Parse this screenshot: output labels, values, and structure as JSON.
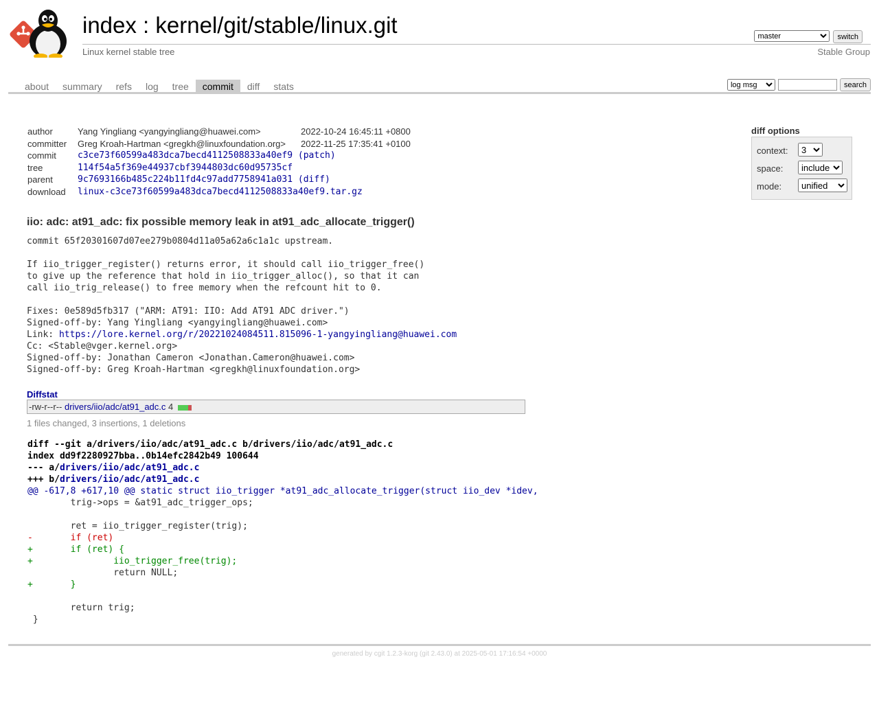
{
  "header": {
    "index_label": "index",
    "separator": " : ",
    "repo_path": "kernel/git/stable/linux.git",
    "description": "Linux kernel stable tree",
    "owner": "Stable Group",
    "branch": "master",
    "switch_label": "switch",
    "logo_icon": "git-penguin-logo"
  },
  "tabs": [
    {
      "label": "about",
      "active": false
    },
    {
      "label": "summary",
      "active": false
    },
    {
      "label": "refs",
      "active": false
    },
    {
      "label": "log",
      "active": false
    },
    {
      "label": "tree",
      "active": false
    },
    {
      "label": "commit",
      "active": true
    },
    {
      "label": "diff",
      "active": false
    },
    {
      "label": "stats",
      "active": false
    }
  ],
  "search": {
    "type": "log msg",
    "query": "",
    "button_label": "search"
  },
  "commit_info": {
    "author_label": "author",
    "author": "Yang Yingliang <yangyingliang@huawei.com>",
    "author_date": "2022-10-24 16:45:11 +0800",
    "committer_label": "committer",
    "committer": "Greg Kroah-Hartman <gregkh@linuxfoundation.org>",
    "committer_date": "2022-11-25 17:35:41 +0100",
    "commit_label": "commit",
    "commit_hash": "c3ce73f60599a483dca7becd4112508833a40ef9",
    "patch_label": "patch",
    "tree_label": "tree",
    "tree_hash": "114f54a5f369e44937cbf3944803dc60d95735cf",
    "parent_label": "parent",
    "parent_hash": "9c7693166b485c224b11fd4c97add7758941a031",
    "diff_label": "diff",
    "download_label": "download",
    "download_file": "linux-c3ce73f60599a483dca7becd4112508833a40ef9.tar.gz"
  },
  "diff_options": {
    "title": "diff options",
    "context_label": "context:",
    "context_value": "3",
    "space_label": "space:",
    "space_value": "include",
    "mode_label": "mode:",
    "mode_value": "unified"
  },
  "message": {
    "subject": "iio: adc: at91_adc: fix possible memory leak in at91_adc_allocate_trigger()",
    "lines": [
      "commit 65f20301607d07ee279b0804d11a05a62a6c1a1c upstream.",
      "",
      "If iio_trigger_register() returns error, it should call iio_trigger_free()",
      "to give up the reference that hold in iio_trigger_alloc(), so that it can",
      "call iio_trig_release() to free memory when the refcount hit to 0.",
      "",
      "Fixes: 0e589d5fb317 (\"ARM: AT91: IIO: Add AT91 ADC driver.\")",
      "Signed-off-by: Yang Yingliang <yangyingliang@huawei.com>"
    ],
    "link_prefix": "Link: ",
    "link_url": "https://lore.kernel.org/r/20221024084511.815096-1-yangyingliang@huawei.com",
    "tail_lines": [
      "Cc: <Stable@vger.kernel.org>",
      "Signed-off-by: Jonathan Cameron <Jonathan.Cameron@huawei.com>",
      "Signed-off-by: Greg Kroah-Hartman <gregkh@linuxfoundation.org>"
    ]
  },
  "diffstat": {
    "title": "Diffstat",
    "mode": "-rw-r--r--",
    "file": "drivers/iio/adc/at91_adc.c",
    "changes": "4",
    "insertions": 3,
    "deletions": 1,
    "summary": "1 files changed, 3 insertions, 1 deletions"
  },
  "diff": {
    "head_git": "diff --git a/drivers/iio/adc/at91_adc.c b/drivers/iio/adc/at91_adc.c",
    "head_index": "index dd9f2280927bba..0b14efc2842b49 100644",
    "minus_prefix": "--- a/",
    "plus_prefix": "+++ b/",
    "file": "drivers/iio/adc/at91_adc.c",
    "hunk": "@@ -617,8 +617,10 @@ static struct iio_trigger *at91_adc_allocate_trigger(struct iio_dev *idev,",
    "lines": [
      {
        "type": "ctx",
        "text": " \ttrig->ops = &at91_adc_trigger_ops;"
      },
      {
        "type": "ctx",
        "text": " "
      },
      {
        "type": "ctx",
        "text": " \tret = iio_trigger_register(trig);"
      },
      {
        "type": "del",
        "text": "-\tif (ret)"
      },
      {
        "type": "add",
        "text": "+\tif (ret) {"
      },
      {
        "type": "add",
        "text": "+\t\tiio_trigger_free(trig);"
      },
      {
        "type": "ctx",
        "text": " \t\treturn NULL;"
      },
      {
        "type": "add",
        "text": "+\t}"
      },
      {
        "type": "ctx",
        "text": " "
      },
      {
        "type": "ctx",
        "text": " \treturn trig;"
      },
      {
        "type": "ctx",
        "text": " }"
      }
    ]
  },
  "footer": {
    "generated_prefix": "generated by ",
    "cgit_link": "cgit 1.2.3-korg",
    "git_version": " (git 2.43.0) at 2025-05-01 17:16:54 +0000"
  }
}
